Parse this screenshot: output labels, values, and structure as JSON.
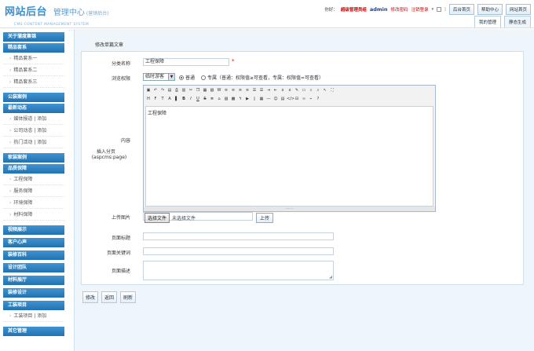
{
  "header": {
    "logo_main": "网站后台",
    "logo_sub": "管理中心",
    "logo_tag": "(营销后台)",
    "logo_en": "CMS CONTENT MANAGEMENT SYSTEM",
    "greeting": "你好：",
    "role": "超级管理员组",
    "username": "admin",
    "change_pwd": "修改密码",
    "logout": "注销登录",
    "home_btn": "后台首页",
    "help_btn": "帮助中心",
    "site_btn": "网站首页",
    "tabs": [
      "我的管理",
      "静态生成"
    ]
  },
  "sidebar": {
    "sections": [
      {
        "title": "关于蒲度集锦",
        "items": []
      },
      {
        "title": "精品套系",
        "items": [
          "精品套系一",
          "精品套系二",
          "精品套系三"
        ]
      },
      {
        "title": "公装案例",
        "items": []
      },
      {
        "title": "最新动态",
        "items": [
          "媒体报道 | 添加",
          "公司动态 | 添加",
          "热门活动 | 添加"
        ]
      },
      {
        "title": "家装案例",
        "items": []
      },
      {
        "title": "品质保障",
        "items": [
          "工程保障",
          "服务保障",
          "环境保障",
          "材料保障"
        ]
      },
      {
        "title": "视频展示",
        "items": []
      },
      {
        "title": "客户心声",
        "items": []
      },
      {
        "title": "装修百科",
        "items": []
      },
      {
        "title": "设计团队",
        "items": []
      },
      {
        "title": "材料展厅",
        "items": []
      },
      {
        "title": "装修设计",
        "items": []
      },
      {
        "title": "工装项目",
        "items": [
          "工装项目 | 添加"
        ]
      },
      {
        "title": "其它管理",
        "items": []
      }
    ]
  },
  "main": {
    "panel_title": "修改单篇文章",
    "form": {
      "category_label": "分类名称",
      "category_value": "工程保障",
      "permission_label": "浏览权限",
      "permission_select": "临时游客",
      "radio_open": "普通",
      "radio_exclusive": "专属（普通：权限值≥可查看，专属：权限值=可查看）",
      "content_label": "内容",
      "insert_page_label": "插入分页",
      "insert_page_code": "(aspcms:page)",
      "content_text": "工程保障",
      "upload_label": "上传图片",
      "file_button": "选择文件",
      "file_status": "未选择文件",
      "upload_button": "上传",
      "page_title_label": "页面标题",
      "page_keywords_label": "页面关键词",
      "page_desc_label": "页面描述"
    },
    "actions": [
      "修改",
      "返回",
      "刷新"
    ]
  }
}
